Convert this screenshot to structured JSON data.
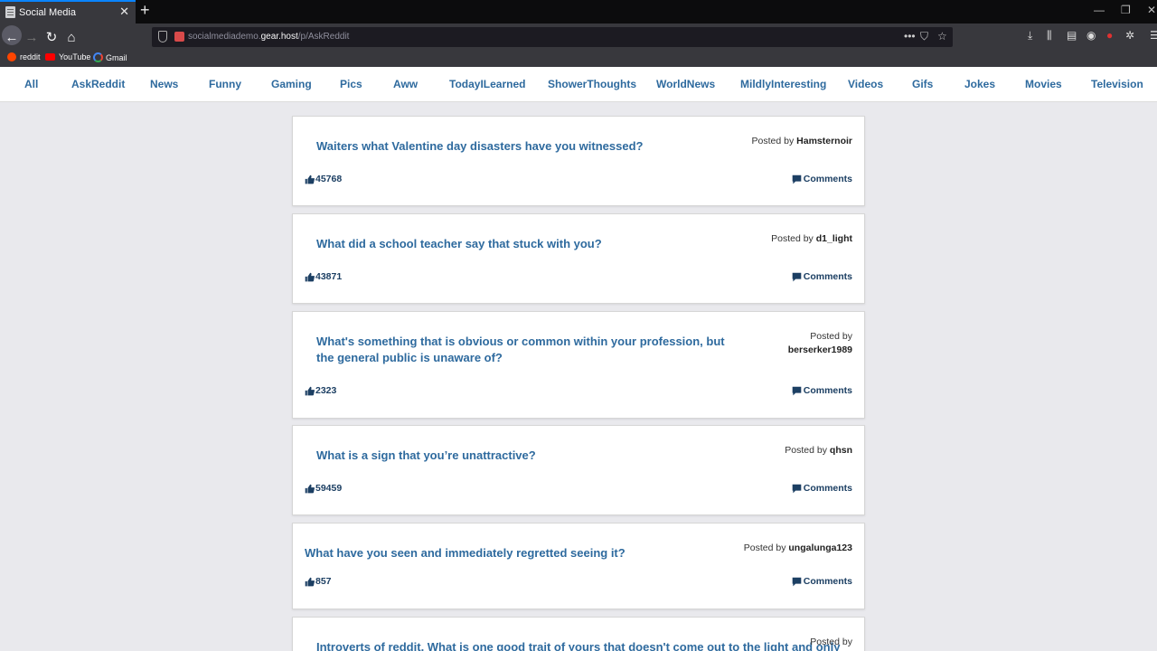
{
  "browser": {
    "tab_title": "Social Media",
    "url_prefix": "socialmediademo.",
    "url_domain": "gear.host",
    "url_path": "/p/AskReddit",
    "bookmarks": [
      "reddit",
      "YouTube",
      "Gmail"
    ]
  },
  "nav": {
    "items": [
      "All",
      "AskReddit",
      "News",
      "Funny",
      "Gaming",
      "Pics",
      "Aww",
      "TodayILearned",
      "ShowerThoughts",
      "WorldNews",
      "MildlyInteresting",
      "Videos",
      "Gifs",
      "Jokes",
      "Movies",
      "Television"
    ],
    "link_color": "#2e6a9e"
  },
  "posts": [
    {
      "title": "Waiters what Valentine day disasters have you witnessed?",
      "posted_by_label": "Posted by",
      "author": "Hamsternoir",
      "likes": "45768",
      "comments_label": "Comments"
    },
    {
      "title": "What did a school teacher say that stuck with you?",
      "posted_by_label": "Posted by",
      "author": "d1_light",
      "likes": "43871",
      "comments_label": "Comments"
    },
    {
      "title": "What's something that is obvious or common within your profession, but the general public is unaware of?",
      "posted_by_label": "Posted by",
      "author": "berserker1989",
      "likes": "2323",
      "comments_label": "Comments"
    },
    {
      "title": "What is a sign that you’re unattractive?",
      "posted_by_label": "Posted by",
      "author": "qhsn",
      "likes": "59459",
      "comments_label": "Comments"
    },
    {
      "title": "What have you seen and immediately regretted seeing it?",
      "posted_by_label": "Posted by",
      "author": "ungalunga123",
      "likes": "857",
      "comments_label": "Comments"
    },
    {
      "title": "Introverts of reddit. What is one good trait of yours that doesn't come out to the light and only",
      "posted_by_label": "Posted by",
      "author": "",
      "likes": "",
      "comments_label": ""
    }
  ],
  "colors": {
    "accent_dark": "#1c3f63",
    "page_bg": "#e9e9ed"
  }
}
